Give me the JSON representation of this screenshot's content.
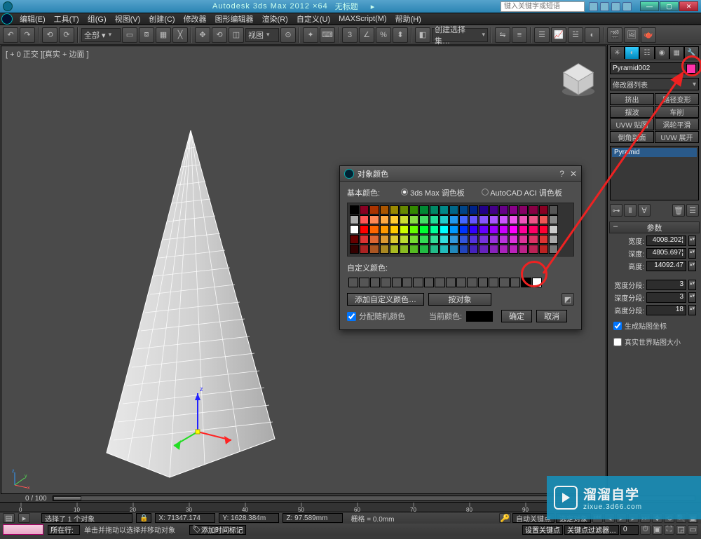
{
  "titlebar": {
    "app_title": "Autodesk 3ds Max 2012 ×64",
    "doc_title": "无标题",
    "search_placeholder": "键入关键字或短语"
  },
  "menu": {
    "items": [
      "编辑(E)",
      "工具(T)",
      "组(G)",
      "视图(V)",
      "创建(C)",
      "修改器",
      "图形编辑器",
      "渲染(R)",
      "自定义(U)",
      "MAXScript(M)",
      "帮助(H)"
    ]
  },
  "toolbar": {
    "all_label": "全部 ▾",
    "view_label": "视图",
    "create_sel_set": "创建选择集…"
  },
  "viewport": {
    "label": "[ + 0 正交 ][真实 + 边面 ]"
  },
  "dialog": {
    "title": "对象颜色",
    "basic_colors": "基本颜色:",
    "palette_3dsmax": "3ds Max 调色板",
    "palette_aci": "AutoCAD ACI 调色板",
    "custom_colors": "自定义颜色:",
    "add_custom": "添加自定义颜色…",
    "by_object": "按对象",
    "assign_random": "分配随机颜色",
    "current_color": "当前颜色:",
    "ok": "确定",
    "cancel": "取消"
  },
  "cmdpanel": {
    "object_name": "Pyramid002",
    "modifier_list": "修改器列表",
    "mods": [
      "挤出",
      "路径变形",
      "摆波",
      "车削",
      "UVW 贴图",
      "涡轮平滑",
      "倒角剖面",
      "UVW 展开"
    ],
    "stack_item": "Pyramid",
    "rollout_title": "参数",
    "params": {
      "width_lbl": "宽度:",
      "width_val": "4008.202¦",
      "depth_lbl": "深度:",
      "depth_val": "4805.697¦",
      "height_lbl": "高度:",
      "height_val": "14092.47",
      "wseg_lbl": "宽度分段:",
      "wseg_val": "3",
      "dseg_lbl": "深度分段:",
      "dseg_val": "3",
      "hseg_lbl": "高度分段:",
      "hseg_val": "18"
    },
    "gen_mapping": "生成贴图坐标",
    "real_world": "真实世界贴图大小"
  },
  "timeline": {
    "range": "0 / 100",
    "selected": "选择了 1 个对象",
    "hint": "单击并拖动以选择并移动对象",
    "add_time_tag": "添加时间标记",
    "x": "X: 71347.174",
    "y": "Y: 1628.384m",
    "z": "Z: 97.589mm",
    "grid": "栅格 = 0.0mm",
    "auto_key": "自动关键点",
    "sel_lock": "选定对象",
    "set_key": "设置关键点",
    "key_filter": "关键点过滤器…",
    "all_rows": "所在行:"
  },
  "watermark": {
    "brand": "溜溜自学",
    "url": "zixue.3d66.com"
  },
  "palette_colors": [
    [
      "#000",
      "#802",
      "#a30",
      "#a50",
      "#980",
      "#680",
      "#380",
      "#083",
      "#086",
      "#088",
      "#068",
      "#048",
      "#028",
      "#208",
      "#408",
      "#608",
      "#808",
      "#806",
      "#804",
      "#802",
      "#555"
    ],
    [
      "#aaa",
      "#f55",
      "#f85",
      "#fa4",
      "#fc3",
      "#cd3",
      "#8d4",
      "#4d6",
      "#2d9",
      "#2cc",
      "#29e",
      "#46f",
      "#65f",
      "#85f",
      "#a5f",
      "#c5f",
      "#e5e",
      "#e5b",
      "#e58",
      "#e55",
      "#888"
    ],
    [
      "#fff",
      "#f00",
      "#f60",
      "#f90",
      "#fc0",
      "#cf0",
      "#6f0",
      "#0f3",
      "#0f9",
      "#0ff",
      "#09f",
      "#03f",
      "#30f",
      "#60f",
      "#90f",
      "#c0f",
      "#f0f",
      "#f09",
      "#f06",
      "#f03",
      "#ccc"
    ],
    [
      "#600",
      "#d33",
      "#d63",
      "#d93",
      "#dc3",
      "#bd3",
      "#7d3",
      "#3d5",
      "#3d9",
      "#3dd",
      "#39d",
      "#35d",
      "#53d",
      "#73d",
      "#93d",
      "#b3d",
      "#d3d",
      "#d39",
      "#d36",
      "#d33",
      "#aaa"
    ],
    [
      "#300",
      "#a22",
      "#a52",
      "#a82",
      "#ab2",
      "#8b2",
      "#5b2",
      "#2b4",
      "#2b8",
      "#2bb",
      "#28b",
      "#24b",
      "#42b",
      "#62b",
      "#82b",
      "#a2b",
      "#b2b",
      "#b28",
      "#b25",
      "#b22",
      "#777"
    ]
  ]
}
